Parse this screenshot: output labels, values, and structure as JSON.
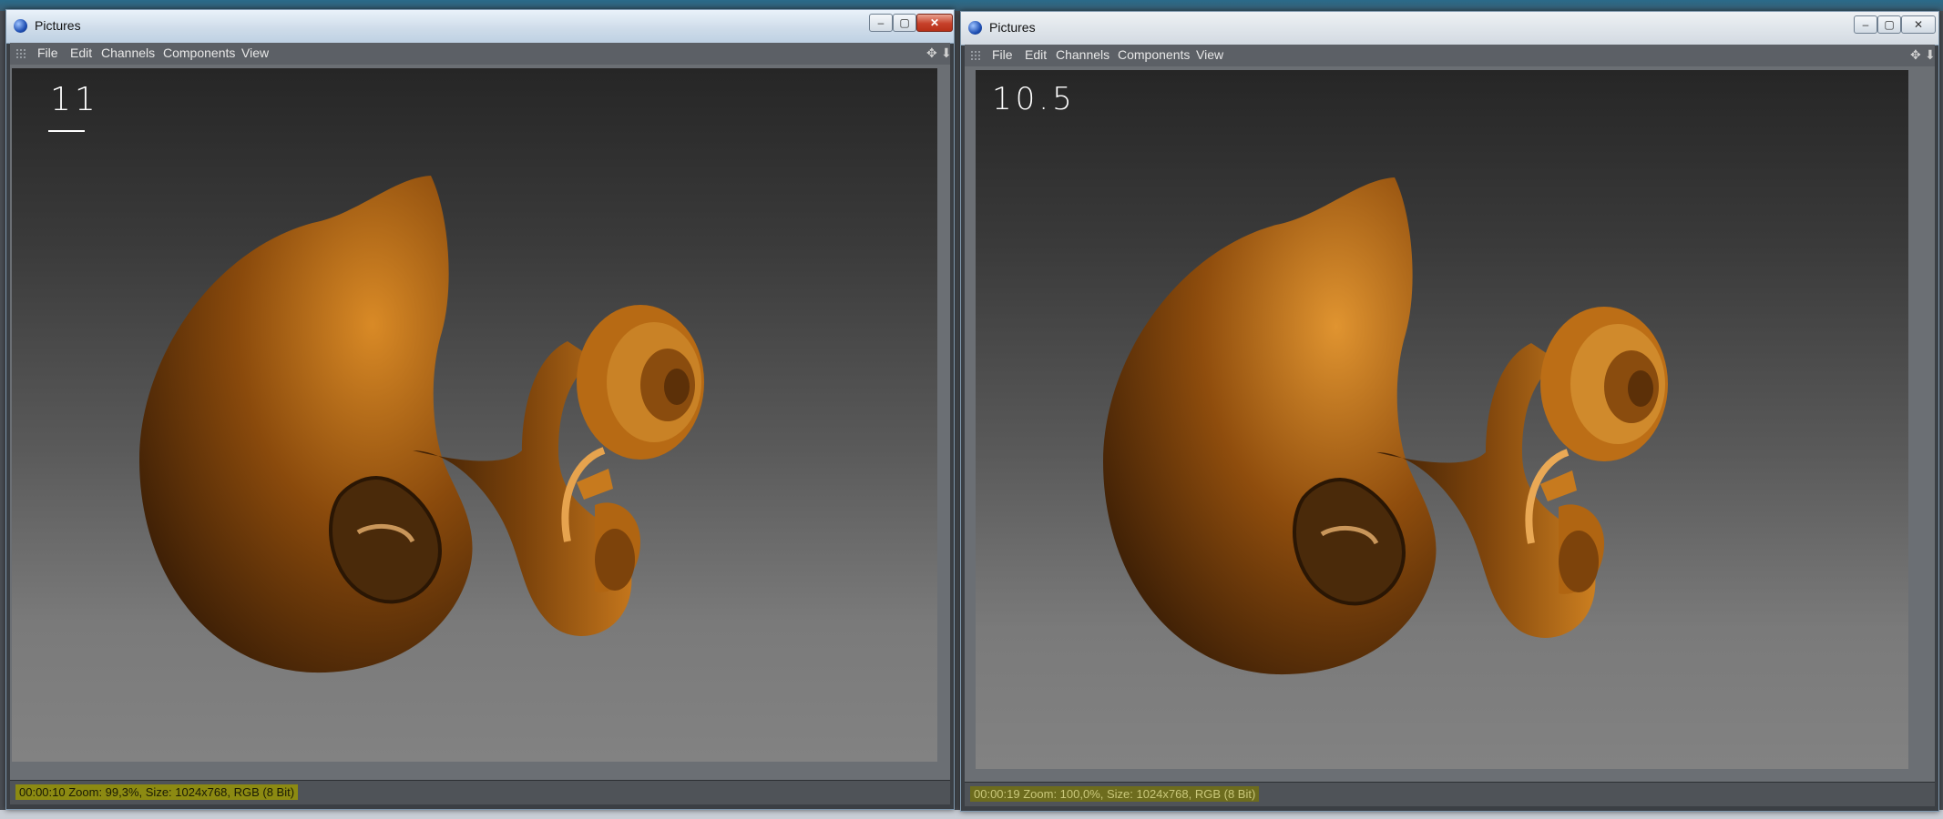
{
  "left_window": {
    "title": "Pictures",
    "menu": [
      "File",
      "Edit",
      "Channels",
      "Components",
      "View"
    ],
    "annotation": "11",
    "status": "00:00:10  Zoom: 99,3%, Size: 1024x768, RGB (8 Bit)"
  },
  "right_window": {
    "title": "Pictures",
    "menu": [
      "File",
      "Edit",
      "Channels",
      "Components",
      "View"
    ],
    "annotation": "10.5",
    "status": "00:00:19  Zoom: 100,0%, Size: 1024x768, RGB (8 Bit)"
  },
  "icons": {
    "app": "cinema-sphere-icon",
    "move": "move-arrows-icon",
    "pin": "pin-down-icon",
    "minimize": "minimize-icon",
    "maximize": "maximize-icon",
    "close": "close-icon"
  },
  "colors": {
    "status_highlight": "#8c8a12",
    "wood": "#b86a12",
    "title_bar": "#cddbe9"
  }
}
